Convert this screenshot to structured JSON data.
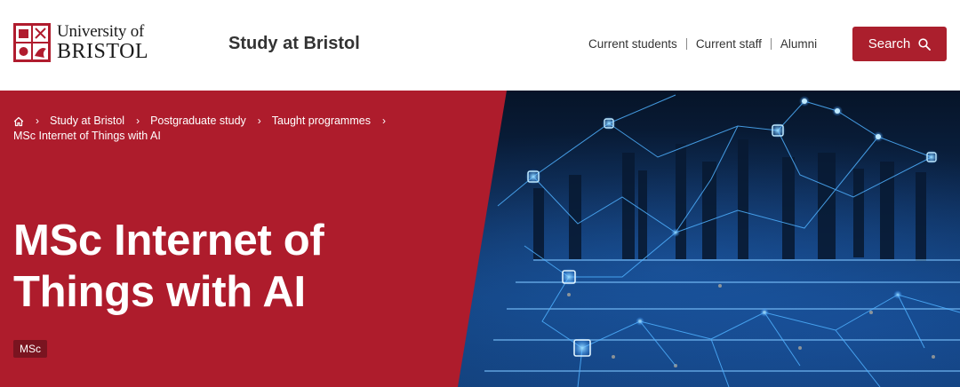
{
  "header": {
    "logo": {
      "line1": "University of",
      "line2": "BRISTOL"
    },
    "site_title": "Study at Bristol",
    "utility_links": [
      "Current students",
      "Current staff",
      "Alumni"
    ],
    "search_label": "Search",
    "search_icon": "search-icon",
    "accent_color": "#ab1f2d"
  },
  "hero": {
    "breadcrumb": {
      "home_icon": "home-icon",
      "items": [
        "Study at Bristol",
        "Postgraduate study",
        "Taught programmes"
      ],
      "current": "MSc Internet of Things with AI",
      "separator": "›"
    },
    "title_line1": "MSc Internet of",
    "title_line2": "Things with AI",
    "tag": "MSc",
    "panel_color": "#ae1c2c",
    "image": "city-network-illustration"
  }
}
